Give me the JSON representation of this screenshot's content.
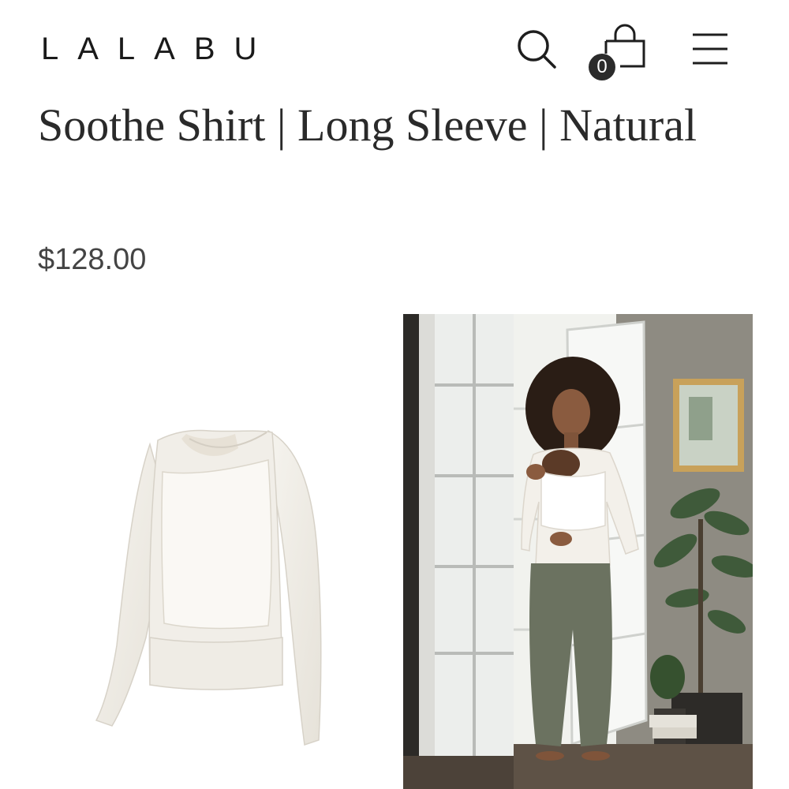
{
  "header": {
    "brand": "LALABU",
    "icons": {
      "search": "search-icon",
      "cart": "shopping-bag-icon",
      "menu": "hamburger-menu-icon"
    },
    "cart_count": "0"
  },
  "product": {
    "title": "Soothe Shirt | Long Sleeve | Natural",
    "price": "$128.00"
  },
  "colors": {
    "text": "#2a2a2a",
    "badge": "#2b2b2b",
    "shirt": "#f3f0ea",
    "pants": "#6b7260"
  }
}
